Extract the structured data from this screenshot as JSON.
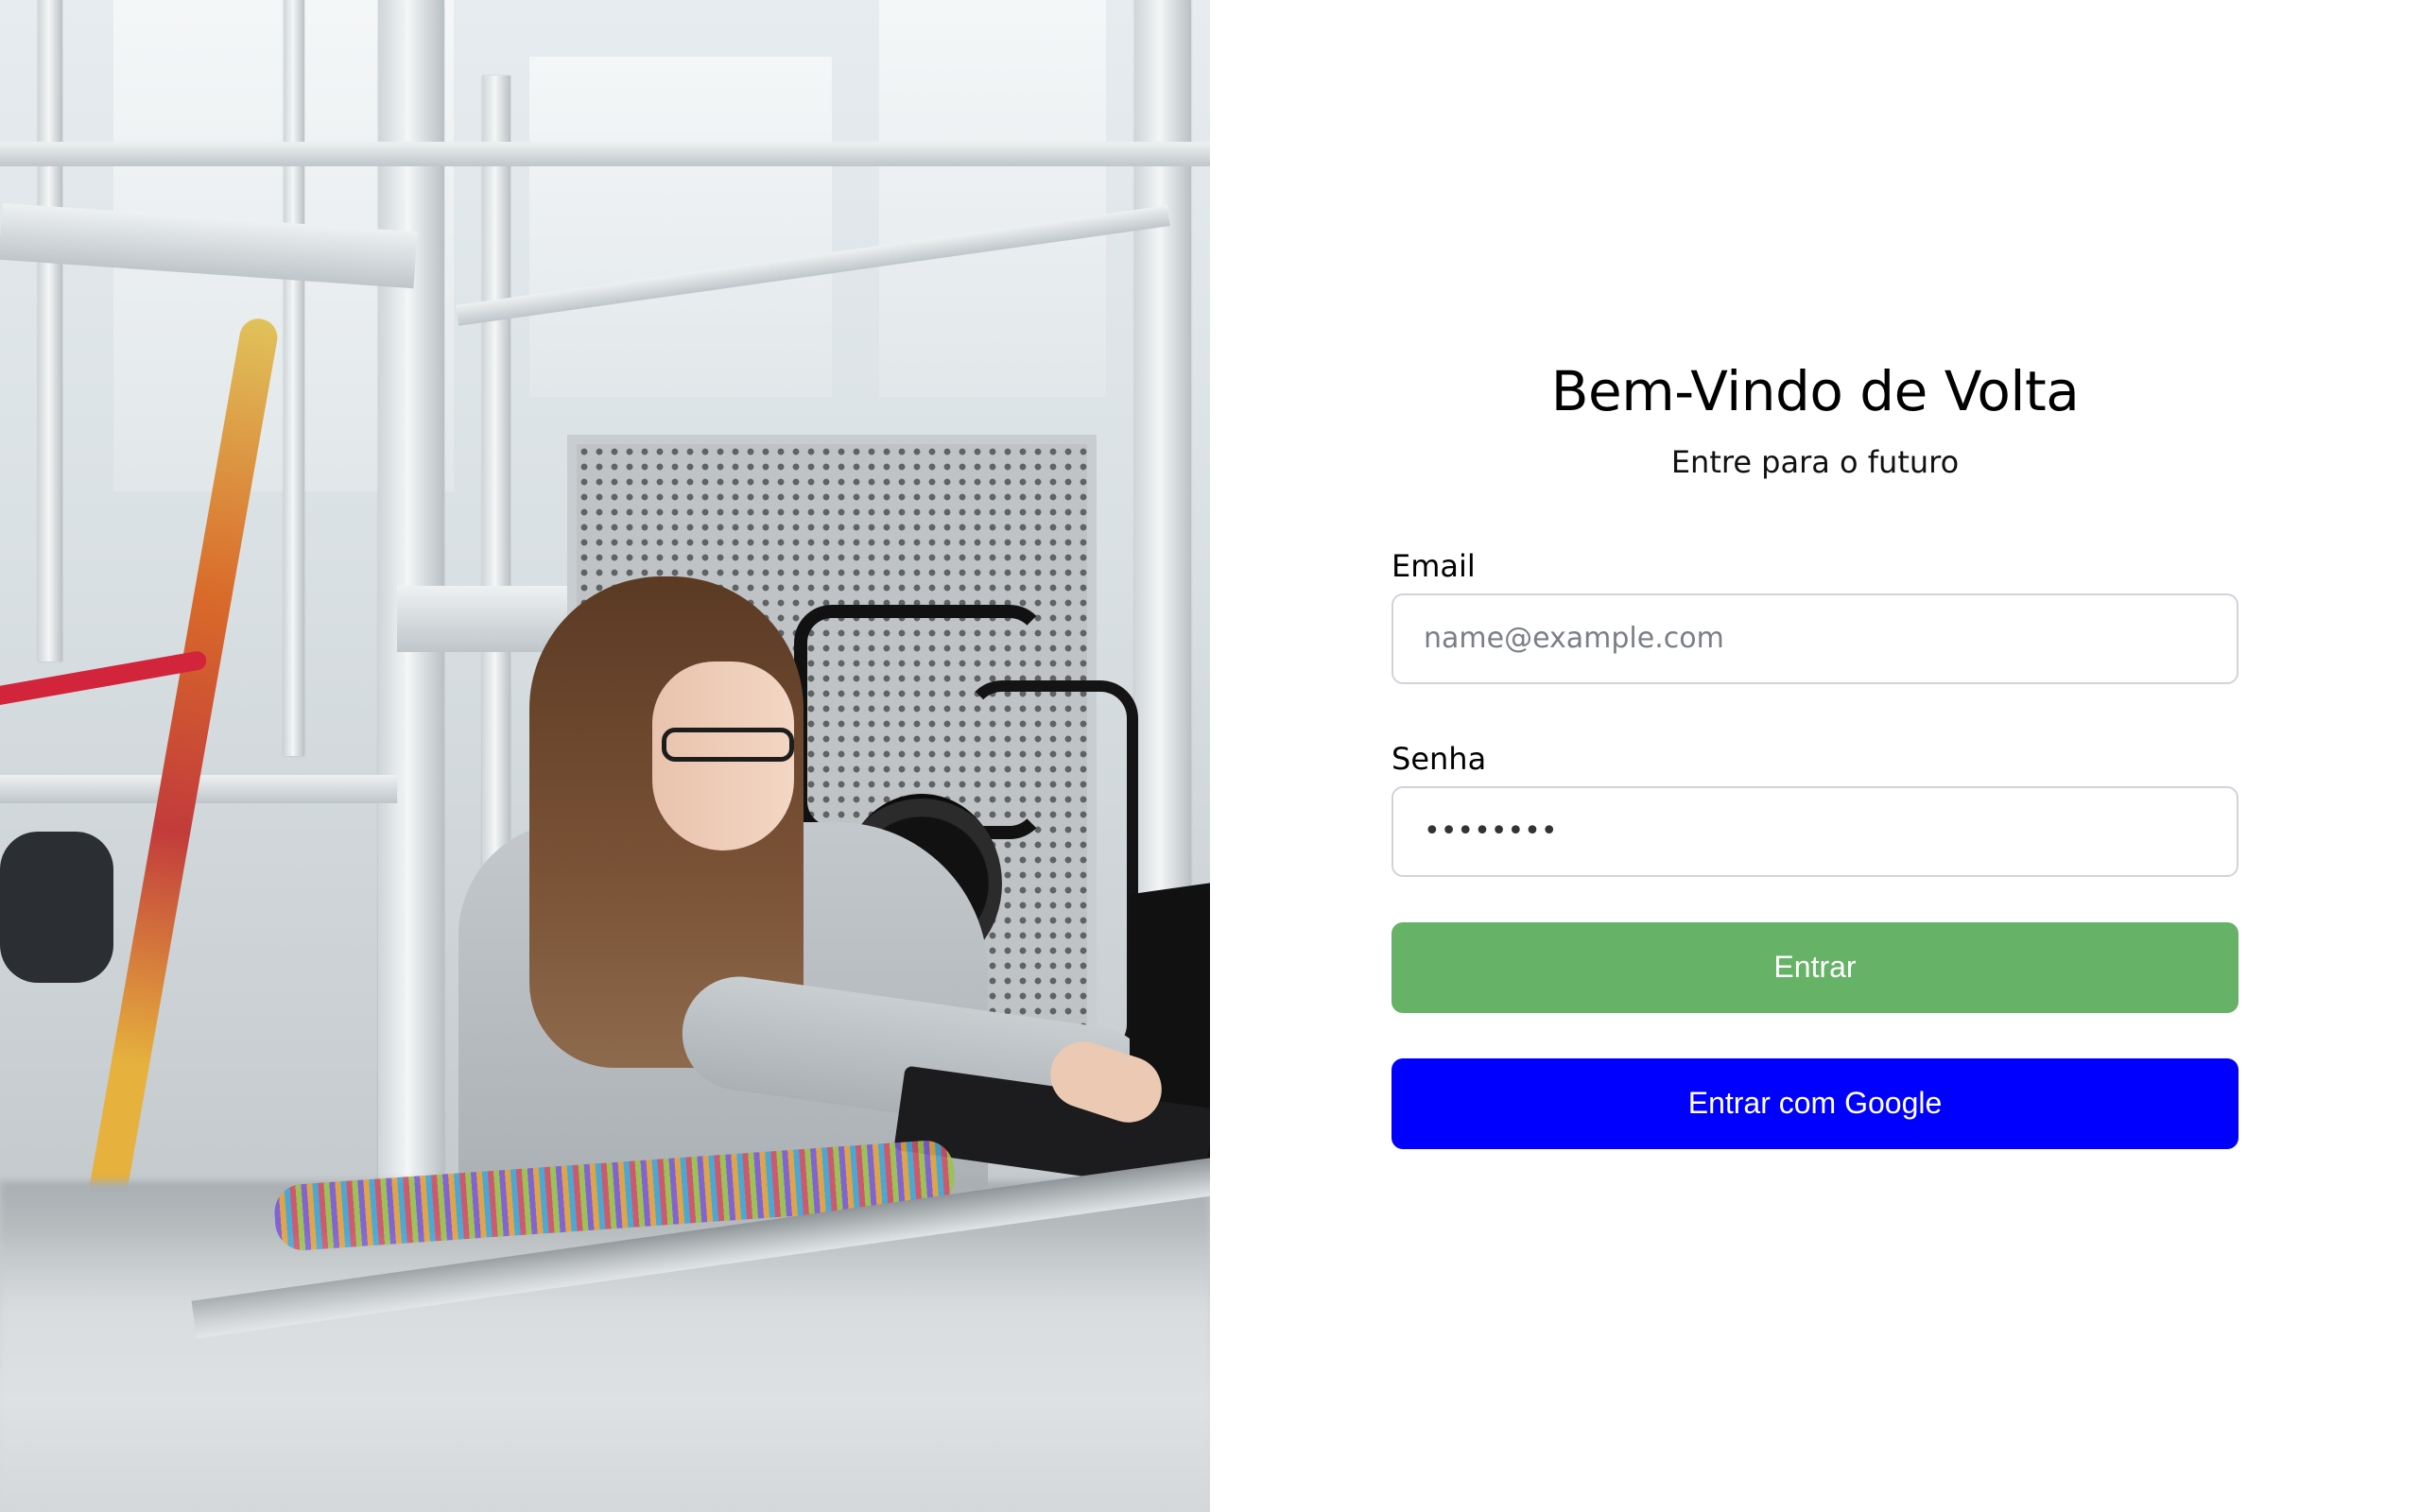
{
  "login": {
    "title": "Bem-Vindo de Volta",
    "subtitle": "Entre para o futuro",
    "email": {
      "label": "Email",
      "placeholder": "name@example.com",
      "value": ""
    },
    "password": {
      "label": "Senha",
      "value": "••••••••"
    },
    "submit_label": "Entrar",
    "google_label": "Entrar com Google"
  },
  "colors": {
    "submit_button": "#66b266",
    "google_button": "#0000ff"
  }
}
